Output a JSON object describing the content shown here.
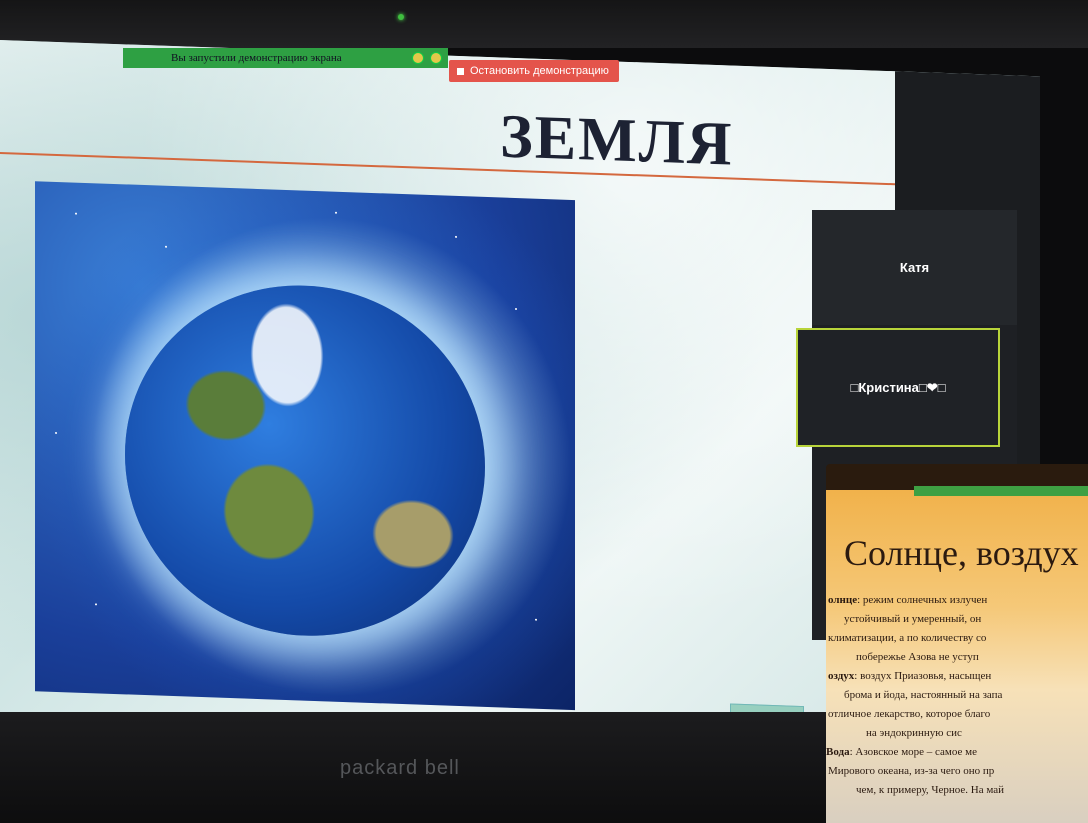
{
  "share_bar": {
    "notice": "Вы запустили демонстрацию экрана",
    "stop_label": "Остановить демонстрацию"
  },
  "slide": {
    "title": "ЗЕМЛЯ"
  },
  "participants": [
    {
      "name": "Катя"
    },
    {
      "name": "□Кристина□❤□"
    }
  ],
  "laptop": {
    "brand": "packard bell"
  },
  "phone_slide": {
    "title": "Солнце, воздух",
    "lines": [
      {
        "bold": "олнце",
        "text": ": режим солнечных излучен"
      },
      {
        "bold": "",
        "text": "устойчивый и умеренный, он"
      },
      {
        "bold": "",
        "text": "климатизации, а по количеству со"
      },
      {
        "bold": "",
        "text": "побережье Азова не уступ"
      },
      {
        "bold": "оздух",
        "text": ": воздух Приазовья, насыщен"
      },
      {
        "bold": "",
        "text": "брома и йода, настоянный на запа"
      },
      {
        "bold": "",
        "text": "отличное лекарство, которое благо"
      },
      {
        "bold": "",
        "text": "на эндокринную сис"
      },
      {
        "bold": "Вода",
        "text": ": Азовское море – самое ме"
      },
      {
        "bold": "",
        "text": "Мирового океана, из-за чего оно пр"
      },
      {
        "bold": "",
        "text": "чем, к примеру, Черное. На май"
      }
    ]
  }
}
